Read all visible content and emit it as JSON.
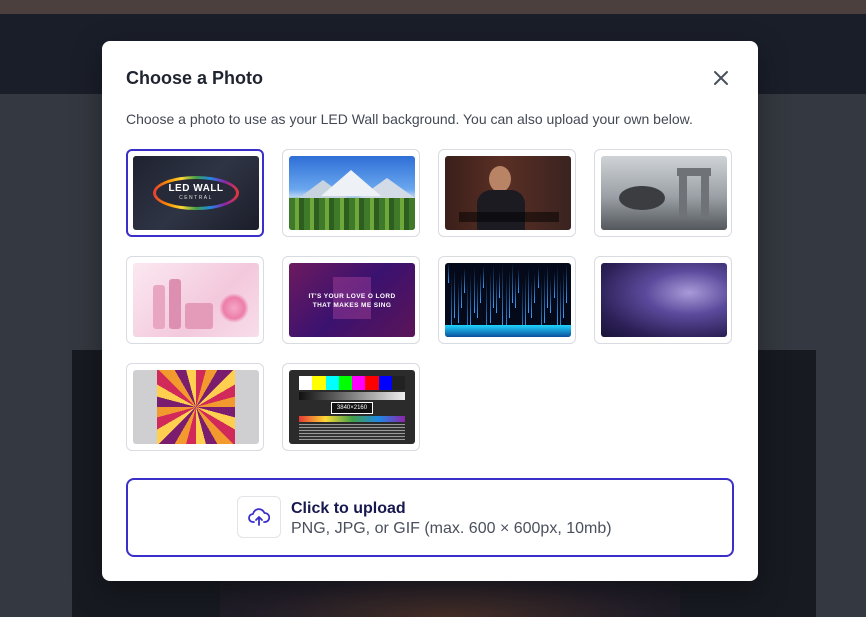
{
  "modal": {
    "title": "Choose a Photo",
    "description": "Choose a photo to use as your LED Wall background. You can also upload your own below.",
    "close_icon": "close-icon"
  },
  "photos": [
    {
      "id": "led-wall-central",
      "selected": true,
      "logo_line1": "LED WALL",
      "logo_line2": "CENTRAL"
    },
    {
      "id": "mountain-landscape",
      "selected": false
    },
    {
      "id": "singer-on-stage",
      "selected": false
    },
    {
      "id": "ancient-ruins",
      "selected": false
    },
    {
      "id": "cosmetics-brand",
      "selected": false
    },
    {
      "id": "worship-lyrics",
      "selected": false,
      "line1": "IT'S YOUR LOVE O LORD",
      "line2": "THAT MAKES ME SING"
    },
    {
      "id": "blue-digital-rain",
      "selected": false
    },
    {
      "id": "purple-grunge",
      "selected": false
    },
    {
      "id": "kaleidoscope",
      "selected": false
    },
    {
      "id": "test-pattern",
      "selected": false,
      "label": "3840×2160"
    }
  ],
  "upload": {
    "icon": "upload-cloud-icon",
    "title": "Click to upload",
    "subtitle": "PNG, JPG, or GIF (max. 600 × 600px, 10mb)"
  },
  "colors": {
    "accent": "#3b2fc9",
    "title_text": "#1f2430",
    "upload_title": "#17184f"
  }
}
